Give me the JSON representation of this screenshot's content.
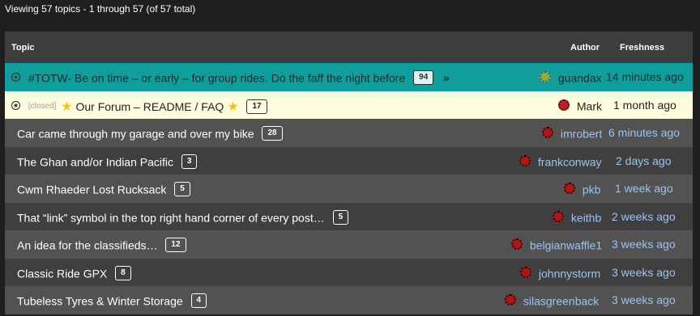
{
  "summary": "Viewing 57 topics - 1 through 57 (of 57 total)",
  "header": {
    "topic": "Topic",
    "author": "Author",
    "freshness": "Freshness"
  },
  "colors": {
    "sticky_row": "#0f9e9c",
    "closed_row": "#fffde0",
    "link": "#9cc4f0"
  },
  "topics": [
    {
      "title": "#TOTW- Be on time – or early – for group rides. Do the faff the night before",
      "count": "94",
      "author": "guandax",
      "freshness": "14 minutes ago",
      "status": "sticky"
    },
    {
      "closed_tag": "[closed]",
      "title": "Our Forum – README / FAQ",
      "count": "17",
      "author": "Mark",
      "freshness": "1 month ago",
      "status": "closed"
    },
    {
      "title": "Car came through my garage and over my bike",
      "count": "28",
      "author": "imrobert",
      "freshness": "6 minutes ago"
    },
    {
      "title": "The Ghan and/or Indian Pacific",
      "count": "3",
      "author": "frankconway",
      "freshness": "2 days ago"
    },
    {
      "title": "Cwm Rhaeder Lost Rucksack",
      "count": "5",
      "author": "pkb",
      "freshness": "1 week ago"
    },
    {
      "title": "That “link” symbol in the top right hand corner of every post…",
      "count": "5",
      "author": "keithb",
      "freshness": "2 weeks ago"
    },
    {
      "title": "An idea for the classifieds…",
      "count": "12",
      "author": "belgianwaffle1",
      "freshness": "3 weeks ago"
    },
    {
      "title": "Classic Ride GPX",
      "count": "8",
      "author": "johnnystorm",
      "freshness": "3 weeks ago"
    },
    {
      "title": "Tubeless Tyres & Winter Storage",
      "count": "4",
      "author": "silasgreenback",
      "freshness": "3 weeks ago"
    }
  ]
}
